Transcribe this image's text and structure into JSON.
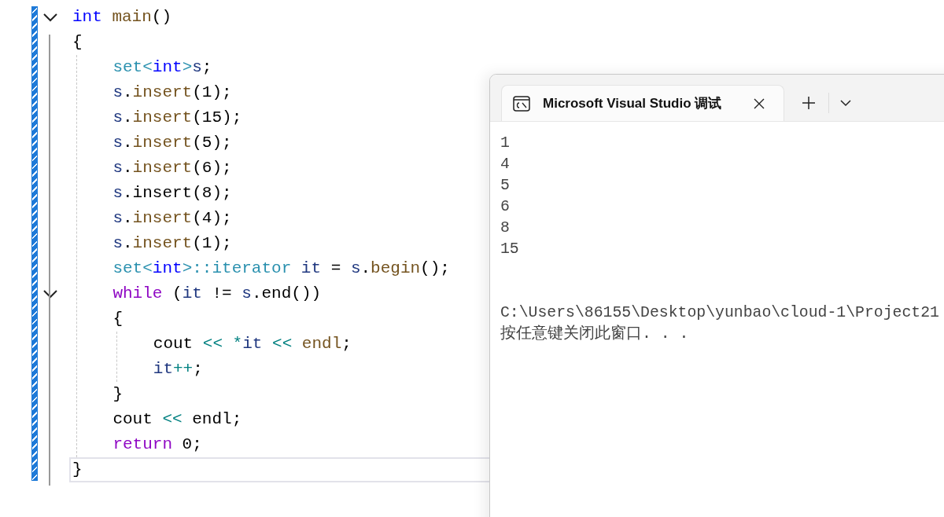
{
  "editor": {
    "lines": [
      {
        "expanded": true,
        "current": false,
        "tokens": [
          {
            "text": "int",
            "kind": "keyword"
          },
          {
            "text": " main",
            "kind": "func"
          },
          {
            "text": "()",
            "kind": "plain"
          }
        ]
      },
      {
        "current": false,
        "tokens": [
          {
            "text": "{",
            "kind": "plain"
          }
        ],
        "children": [
          {
            "current": false,
            "tokens": [
              {
                "text": "set<",
                "kind": "type"
              },
              {
                "text": "int",
                "kind": "keyword"
              },
              {
                "text": ">",
                "kind": "type"
              },
              {
                "text": "s",
                "kind": "var"
              },
              {
                "text": ";",
                "kind": "plain"
              }
            ]
          },
          {
            "current": false,
            "tokens": [
              {
                "text": "s",
                "kind": "var"
              },
              {
                "text": ".",
                "kind": "plain"
              },
              {
                "text": "insert",
                "kind": "func"
              },
              {
                "text": "(1);",
                "kind": "plain"
              }
            ]
          },
          {
            "current": false,
            "tokens": [
              {
                "text": "s",
                "kind": "var"
              },
              {
                "text": ".",
                "kind": "plain"
              },
              {
                "text": "insert",
                "kind": "func"
              },
              {
                "text": "(15);",
                "kind": "plain"
              }
            ]
          },
          {
            "current": false,
            "tokens": [
              {
                "text": "s",
                "kind": "var"
              },
              {
                "text": ".",
                "kind": "plain"
              },
              {
                "text": "insert",
                "kind": "func"
              },
              {
                "text": "(5);",
                "kind": "plain"
              }
            ]
          },
          {
            "current": false,
            "tokens": [
              {
                "text": "s",
                "kind": "var"
              },
              {
                "text": ".",
                "kind": "plain"
              },
              {
                "text": "insert",
                "kind": "func"
              },
              {
                "text": "(6);",
                "kind": "plain"
              }
            ]
          },
          {
            "current": false,
            "tokens": [
              {
                "text": "s",
                "kind": "var"
              },
              {
                "text": ".",
                "kind": "plain"
              },
              {
                "text": "insert",
                "kind": "plain"
              },
              {
                "text": "(8);",
                "kind": "plain"
              }
            ]
          },
          {
            "current": false,
            "tokens": [
              {
                "text": "s",
                "kind": "var"
              },
              {
                "text": ".",
                "kind": "plain"
              },
              {
                "text": "insert",
                "kind": "func"
              },
              {
                "text": "(4);",
                "kind": "plain"
              }
            ]
          },
          {
            "current": false,
            "tokens": [
              {
                "text": "s",
                "kind": "var"
              },
              {
                "text": ".",
                "kind": "plain"
              },
              {
                "text": "insert",
                "kind": "func"
              },
              {
                "text": "(1);",
                "kind": "plain"
              }
            ]
          },
          {
            "current": false,
            "tokens": [
              {
                "text": "set<",
                "kind": "type"
              },
              {
                "text": "int",
                "kind": "keyword"
              },
              {
                "text": ">::iterator",
                "kind": "type"
              },
              {
                "text": " it",
                "kind": "var"
              },
              {
                "text": " = ",
                "kind": "plain"
              },
              {
                "text": "s",
                "kind": "var"
              },
              {
                "text": ".",
                "kind": "plain"
              },
              {
                "text": "begin",
                "kind": "func"
              },
              {
                "text": "();",
                "kind": "plain"
              }
            ]
          },
          {
            "expanded": true,
            "current": false,
            "tokens": [
              {
                "text": "while",
                "kind": "control"
              },
              {
                "text": " (",
                "kind": "plain"
              },
              {
                "text": "it",
                "kind": "var"
              },
              {
                "text": " != ",
                "kind": "plain"
              },
              {
                "text": "s",
                "kind": "var"
              },
              {
                "text": ".",
                "kind": "plain"
              },
              {
                "text": "end())",
                "kind": "plain"
              }
            ]
          },
          {
            "current": false,
            "tokens": [
              {
                "text": "{",
                "kind": "plain"
              }
            ],
            "children": [
              {
                "current": false,
                "tokens": [
                  {
                    "text": "cout",
                    "kind": "plain"
                  },
                  {
                    "text": " <<",
                    "kind": "op"
                  },
                  {
                    "text": " *",
                    "kind": "op"
                  },
                  {
                    "text": "it",
                    "kind": "var"
                  },
                  {
                    "text": " <<",
                    "kind": "op"
                  },
                  {
                    "text": " endl",
                    "kind": "func"
                  },
                  {
                    "text": ";",
                    "kind": "plain"
                  }
                ]
              },
              {
                "current": false,
                "tokens": [
                  {
                    "text": "it",
                    "kind": "var"
                  },
                  {
                    "text": "++",
                    "kind": "op"
                  },
                  {
                    "text": ";",
                    "kind": "plain"
                  }
                ]
              }
            ]
          },
          {
            "current": false,
            "tokens": [
              {
                "text": "}",
                "kind": "plain"
              }
            ]
          },
          {
            "current": false,
            "tokens": [
              {
                "text": "cout",
                "kind": "plain"
              },
              {
                "text": " <<",
                "kind": "op"
              },
              {
                "text": " endl",
                "kind": "plain"
              },
              {
                "text": ";",
                "kind": "plain"
              }
            ]
          },
          {
            "current": false,
            "tokens": [
              {
                "text": "return",
                "kind": "control"
              },
              {
                "text": " 0;",
                "kind": "plain"
              }
            ]
          }
        ]
      },
      {
        "current": true,
        "tokens": [
          {
            "text": "}",
            "kind": "plain"
          }
        ]
      }
    ]
  },
  "terminal": {
    "tab": {
      "title": "Microsoft Visual Studio 调试",
      "selected": true
    },
    "output": [
      "1",
      "4",
      "5",
      "6",
      "8",
      "15"
    ],
    "prompt": [
      "C:\\Users\\86155\\Desktop\\yunbao\\cloud-1\\Project21",
      "按任意键关闭此窗口. . ."
    ]
  }
}
